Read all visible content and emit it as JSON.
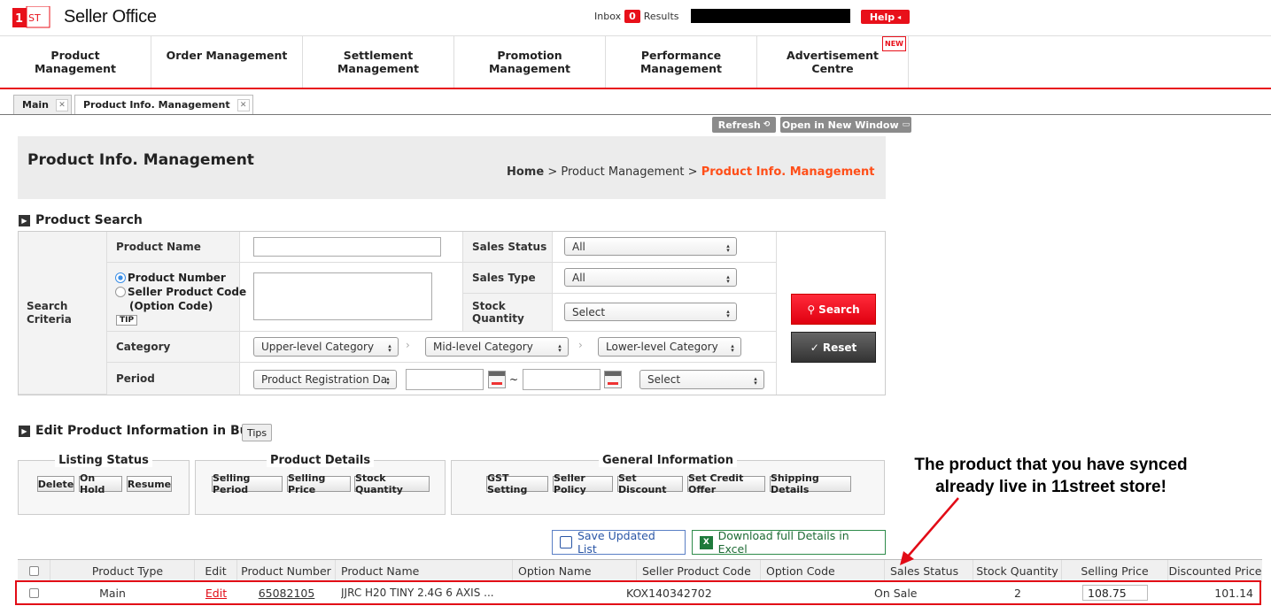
{
  "header": {
    "logo_mark": "11ST",
    "app_title": "Seller Office",
    "inbox_label": "Inbox",
    "inbox_count": "0",
    "results_label": "Results",
    "help_label": "Help"
  },
  "nav": {
    "items": [
      {
        "label": "Product\nManagement"
      },
      {
        "label": "Order Management"
      },
      {
        "label": "Settlement\nManagement"
      },
      {
        "label": "Promotion\nManagement"
      },
      {
        "label": "Performance\nManagement"
      },
      {
        "label": "Advertisement\nCentre",
        "badge": "NEW"
      }
    ]
  },
  "tabs": [
    {
      "label": "Main"
    },
    {
      "label": "Product Info. Management"
    }
  ],
  "toolbar": {
    "refresh_label": "Refresh",
    "new_window_label": "Open in New Window"
  },
  "page": {
    "title": "Product Info. Management",
    "breadcrumb": {
      "home": "Home",
      "sep": ">",
      "parent": "Product Management",
      "current": "Product Info. Management"
    }
  },
  "search": {
    "section_title": "Product Search",
    "criteria_label": "Search\nCriteria",
    "product_name_label": "Product Name",
    "product_number_label": "Product Number",
    "seller_code_label": "Seller Product Code",
    "option_code_label": "(Option Code)",
    "tip_label": "TIP",
    "sales_status_label": "Sales Status",
    "sales_status_value": "All",
    "sales_type_label": "Sales Type",
    "sales_type_value": "All",
    "stock_label": "Stock\nQuantity",
    "stock_value": "Select",
    "category_label": "Category",
    "upper_cat": "Upper-level Category",
    "mid_cat": "Mid-level Category",
    "lower_cat": "Lower-level Category",
    "period_label": "Period",
    "period_type": "Product Registration Da",
    "period_sep": "~",
    "period_select": "Select",
    "search_btn": "Search",
    "reset_btn": "Reset"
  },
  "bulk": {
    "section_title": "Edit Product Information in Bulk",
    "tips_label": "Tips",
    "groups": [
      {
        "title": "Listing Status",
        "buttons": [
          "Delete",
          "On Hold",
          "Resume"
        ]
      },
      {
        "title": "Product Details",
        "buttons": [
          "Selling Period",
          "Selling Price",
          "Stock Quantity"
        ]
      },
      {
        "title": "General Information",
        "buttons": [
          "GST Setting",
          "Seller Policy",
          "Set Discount",
          "Set Credit Offer",
          "Shipping Details"
        ]
      }
    ]
  },
  "list_actions": {
    "save_label": "Save Updated List",
    "excel_label": "Download full Details in Excel"
  },
  "grid": {
    "headers": [
      "Product Type",
      "Edit",
      "Product Number",
      "Product Name",
      "Option Name",
      "Seller Product Code",
      "Option Code",
      "Sales Status",
      "Stock Quantity",
      "Selling Price",
      "Discounted Price"
    ],
    "row": {
      "product_type": "Main",
      "edit": "Edit",
      "product_number": "65082105",
      "product_name": "JJRC H20 TINY 2.4G 6 AXIS ...",
      "option_name": "",
      "seller_code": "KOX140342702",
      "option_code": "",
      "sales_status": "On Sale",
      "stock": "2",
      "selling_price": "108.75",
      "discounted_price": "101.14"
    }
  },
  "annotation": {
    "text": "The product that you have synced\nalready live in 11street store!",
    "color": "#e20b16"
  }
}
